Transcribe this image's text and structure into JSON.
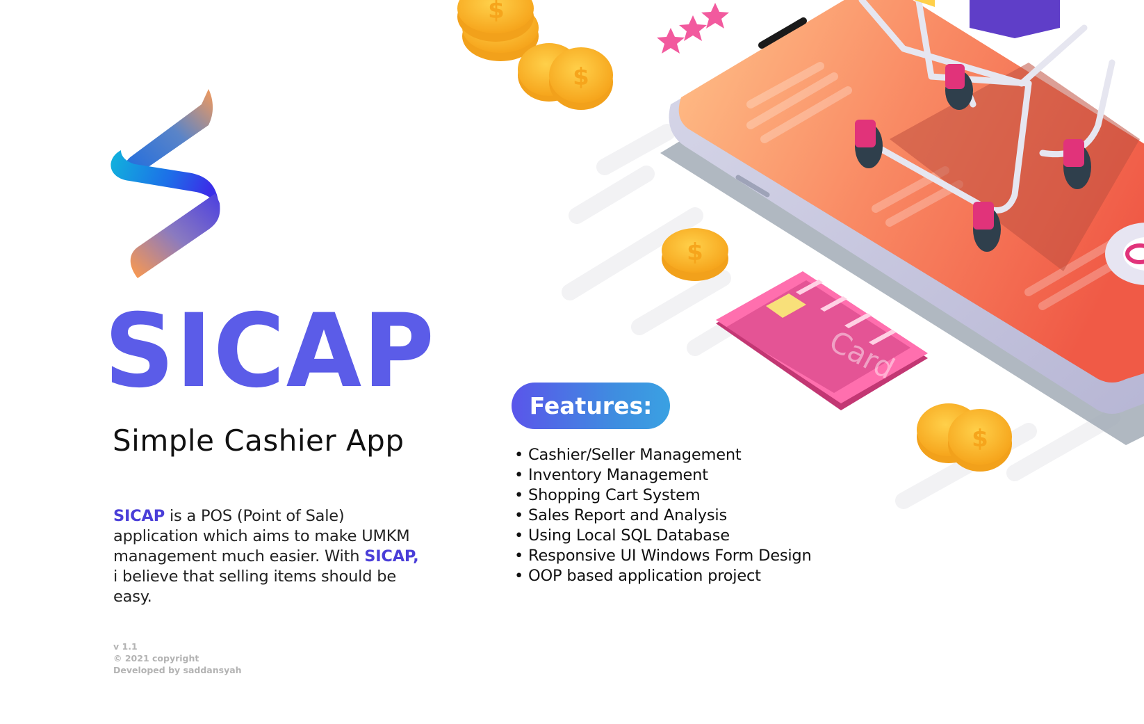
{
  "app": {
    "title": "SICAP",
    "subtitle": "Simple Cashier App"
  },
  "description": {
    "brand": "SICAP",
    "part1": " is a POS (Point of Sale) application which aims to make UMKM management much easier. With ",
    "brand_again": "SICAP,",
    "part2": " i believe that selling items should be easy."
  },
  "features": {
    "heading": "Features:",
    "items": [
      "Cashier/Seller Management",
      "Inventory Management",
      "Shopping Cart System",
      "Sales Report and Analysis",
      "Using Local SQL Database",
      "Responsive UI Windows Form Design",
      "OOP based application project"
    ]
  },
  "footer": {
    "version": "v 1.1",
    "copyright": "© 2021 copyright",
    "developer": "Developed by saddansyah"
  },
  "illustration": {
    "card_label": "Card",
    "coin_symbol": "$"
  },
  "colors": {
    "brand_purple": "#5b5ce8",
    "badge_start": "#5a55ea",
    "badge_end": "#3aa1e2",
    "footer_gray": "#b3b3b3"
  }
}
